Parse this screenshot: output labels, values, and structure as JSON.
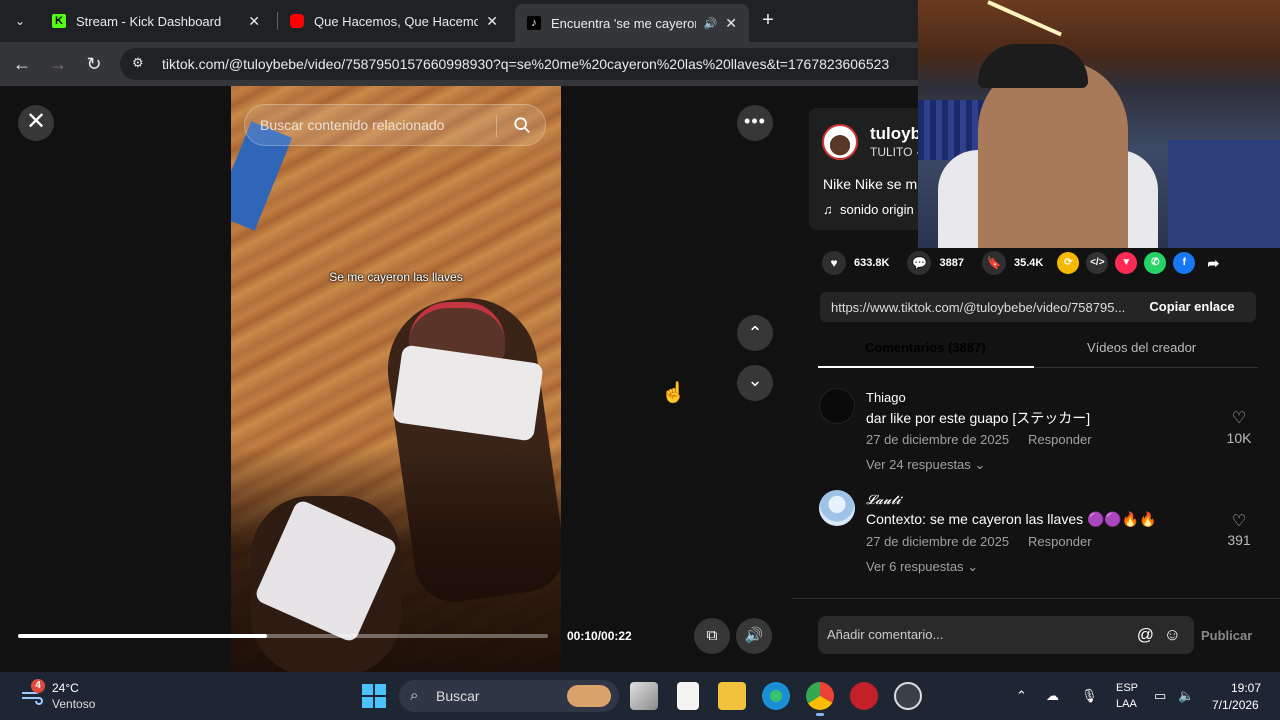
{
  "browser": {
    "tabs": [
      {
        "title": "Stream - Kick Dashboard",
        "favicon": "kick-icon"
      },
      {
        "title": "Que Hacemos, Que Hacemos -",
        "favicon": "youtube-icon"
      },
      {
        "title": "Encuentra 'se me cayeron la",
        "favicon": "tiktok-icon",
        "active": true
      }
    ],
    "new_tab_label": "+",
    "url": "tiktok.com/@tuloybebe/video/7587950157660998930?q=se%20me%20cayeron%20las%20llaves&t=1767823606523"
  },
  "player": {
    "search_placeholder": "Buscar contenido relacionado",
    "video_caption": "Se me cayeron las llaves",
    "time": "00:10/00:22",
    "progress_fraction": 0.47
  },
  "author": {
    "username": "tuloyb",
    "nickname": "TULITO ·",
    "description": "Nike Nike se m",
    "sound": "sonido origin"
  },
  "stats": {
    "likes": "633.8K",
    "comments": "3887",
    "saves": "35.4K"
  },
  "link": {
    "url": "https://www.tiktok.com/@tuloybebe/video/758795...",
    "copy_label": "Copiar enlace"
  },
  "tabs": {
    "comments": "Comentarios (3887)",
    "creator_videos": "Vídeos del creador"
  },
  "comments": [
    {
      "user": "Thiago",
      "text": "dar like por este guapo [ステッカー]",
      "date": "27 de diciembre de 2025",
      "reply": "Responder",
      "likes": "10K",
      "more": "Ver 24 respuestas"
    },
    {
      "user": "𝓛𝓪𝓾𝓽𝓲",
      "text": "Contexto: se me cayeron las llaves 🟣🟣🔥🔥",
      "date": "27 de diciembre de 2025",
      "reply": "Responder",
      "likes": "391",
      "more": "Ver 6 respuestas"
    }
  ],
  "compose": {
    "placeholder": "Añadir comentario...",
    "publish": "Publicar"
  },
  "taskbar": {
    "weather_badge": "4",
    "temperature": "24°C",
    "weather": "Ventoso",
    "search": "Buscar",
    "lang1": "ESP",
    "lang2": "LAA",
    "time": "19:07",
    "date": "7/1/2026"
  },
  "colors": {
    "tiktok_red": "#fe2c55",
    "accent_blue": "#4cc2ff"
  }
}
